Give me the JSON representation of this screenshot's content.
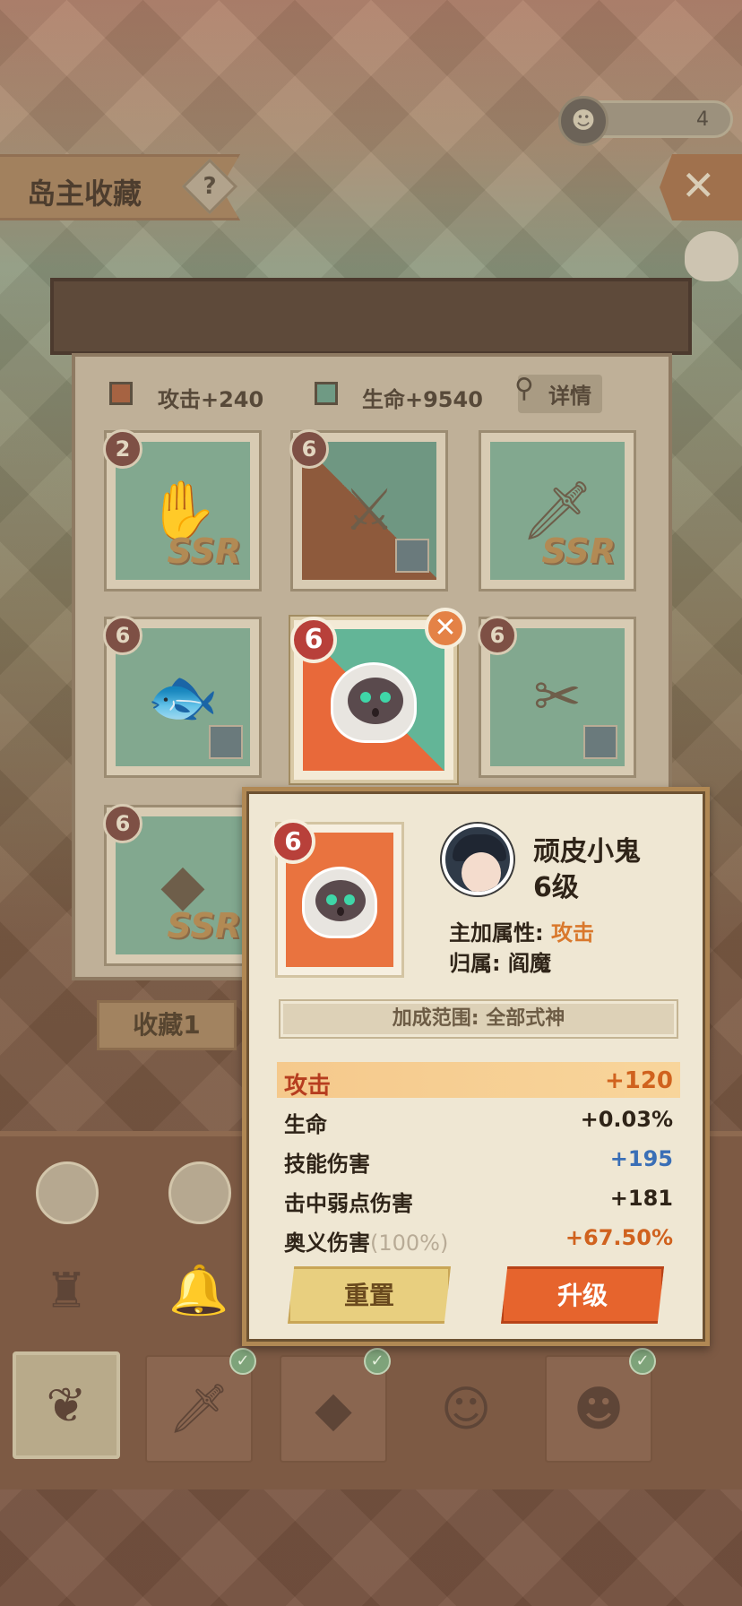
{
  "header": {
    "title": "岛主收藏",
    "help_icon": "?",
    "currency_count": "4",
    "close_icon": "✕"
  },
  "panel": {
    "stats": {
      "attack": "攻击+240",
      "life": "生命+9540",
      "detail": "详情"
    },
    "cards": [
      {
        "level": "2",
        "badge": "SSR"
      },
      {
        "level": "6"
      },
      {
        "badge": "SSR"
      },
      {
        "level": "6"
      },
      {
        "level": "6"
      },
      {
        "level": "6",
        "badge": "SSR"
      }
    ],
    "selected_level": "6",
    "collection_tab": "收藏1"
  },
  "popup": {
    "card_level": "6",
    "name": "顽皮小鬼",
    "level": "6级",
    "main_attr_label": "主加属性:",
    "main_attr_value": "攻击",
    "owner": "归属: 阎魔",
    "range": "加成范围: 全部式神",
    "stats": [
      {
        "label": "攻击",
        "value": "+120"
      },
      {
        "label": "生命",
        "value": "+0.03%"
      },
      {
        "label": "技能伤害",
        "value": "+195"
      },
      {
        "label": "击中弱点伤害",
        "value": "+181"
      },
      {
        "label": "奥义伤害",
        "sub": "(100%)",
        "value": "+67.50%"
      }
    ],
    "reset_btn": "重置",
    "upgrade_btn": "升级"
  }
}
